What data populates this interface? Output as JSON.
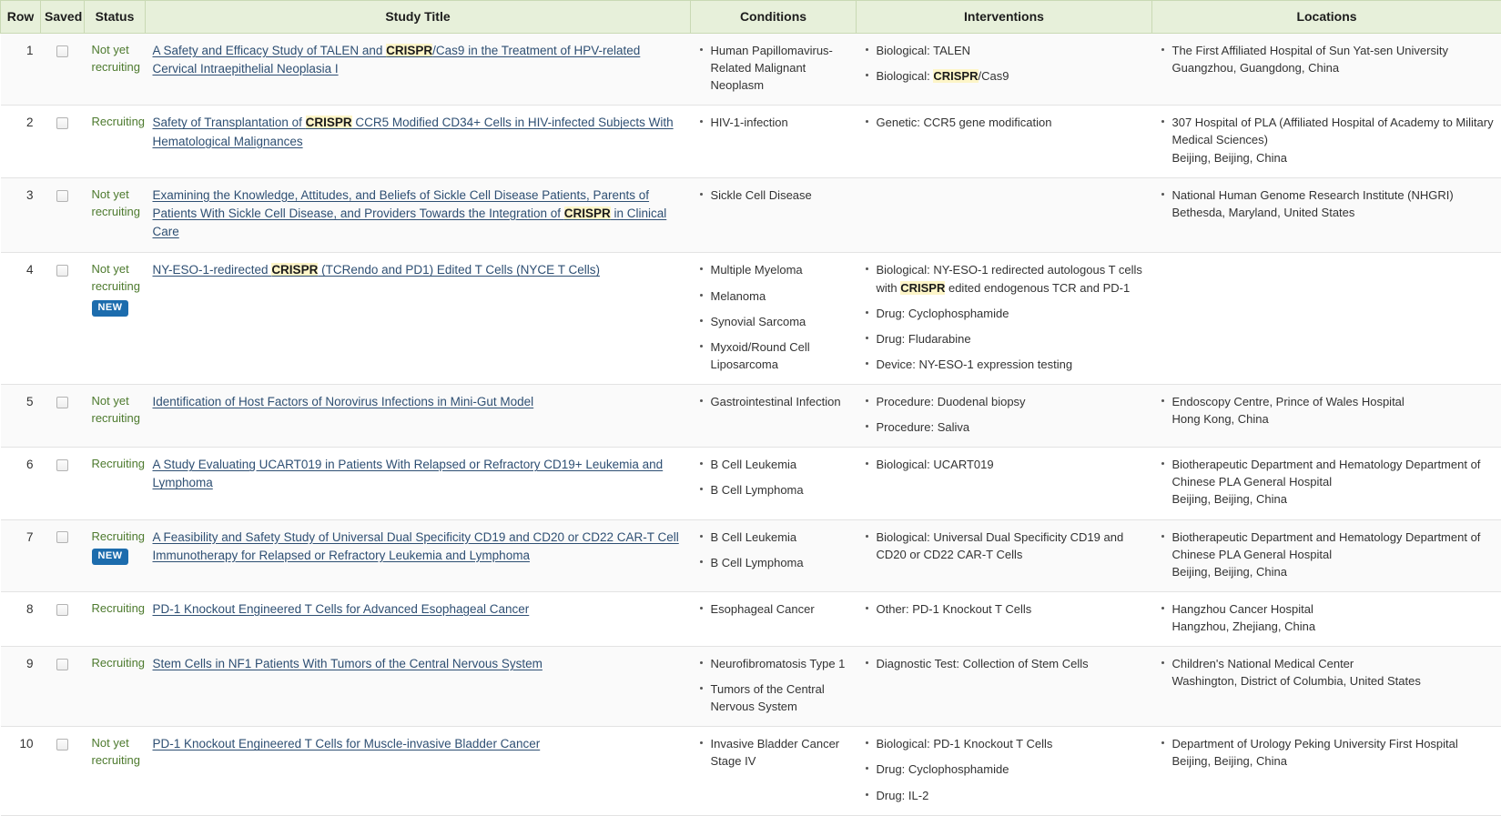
{
  "table": {
    "columns": [
      {
        "key": "row",
        "label": "Row"
      },
      {
        "key": "saved",
        "label": "Saved"
      },
      {
        "key": "status",
        "label": "Status"
      },
      {
        "key": "title",
        "label": "Study Title"
      },
      {
        "key": "conditions",
        "label": "Conditions"
      },
      {
        "key": "interventions",
        "label": "Interventions"
      },
      {
        "key": "locations",
        "label": "Locations"
      }
    ],
    "search_term_highlighted": "CRISPR",
    "badge_new_label": "NEW",
    "colors": {
      "header_bg": "#e7f0da",
      "header_border": "#c9d9b4",
      "status_green": "#4d7a2e",
      "link_blue": "#2e4f73",
      "highlight_yellow": "#fdf5c8",
      "badge_blue": "#1c6cad",
      "row_stripe": "#fafafa"
    },
    "rows": [
      {
        "row": "1",
        "saved": false,
        "status": "Not yet recruiting",
        "new": false,
        "title": "A Safety and Efficacy Study of TALEN and CRISPR/Cas9 in the Treatment of HPV-related Cervical Intraepithelial Neoplasia I",
        "conditions": [
          "Human Papillomavirus-Related Malignant Neoplasm"
        ],
        "interventions": [
          "Biological: TALEN",
          "Biological: CRISPR/Cas9"
        ],
        "locations": [
          {
            "name": "The First Affiliated Hospital of Sun Yat-sen University",
            "place": "Guangzhou, Guangdong, China"
          }
        ]
      },
      {
        "row": "2",
        "saved": false,
        "status": "Recruiting",
        "new": false,
        "title": "Safety of Transplantation of CRISPR CCR5 Modified CD34+ Cells in HIV-infected Subjects With Hematological Malignances",
        "conditions": [
          "HIV-1-infection"
        ],
        "interventions": [
          "Genetic: CCR5 gene modification"
        ],
        "locations": [
          {
            "name": "307 Hospital of PLA (Affiliated Hospital of Academy to Military Medical Sciences)",
            "place": "Beijing, Beijing, China"
          }
        ]
      },
      {
        "row": "3",
        "saved": false,
        "status": "Not yet recruiting",
        "new": false,
        "title": "Examining the Knowledge, Attitudes, and Beliefs of Sickle Cell Disease Patients, Parents of Patients With Sickle Cell Disease, and Providers Towards the Integration of CRISPR in Clinical Care",
        "conditions": [
          "Sickle Cell Disease"
        ],
        "interventions": [],
        "locations": [
          {
            "name": "National Human Genome Research Institute (NHGRI)",
            "place": "Bethesda, Maryland, United States"
          }
        ]
      },
      {
        "row": "4",
        "saved": false,
        "status": "Not yet recruiting",
        "new": true,
        "title": "NY-ESO-1-redirected CRISPR (TCRendo and PD1) Edited T Cells (NYCE T Cells)",
        "conditions": [
          "Multiple Myeloma",
          "Melanoma",
          "Synovial Sarcoma",
          "Myxoid/Round Cell Liposarcoma"
        ],
        "interventions": [
          "Biological: NY-ESO-1 redirected autologous T cells with CRISPR edited endogenous TCR and PD-1",
          "Drug: Cyclophosphamide",
          "Drug: Fludarabine",
          "Device: NY-ESO-1 expression testing"
        ],
        "locations": []
      },
      {
        "row": "5",
        "saved": false,
        "status": "Not yet recruiting",
        "new": false,
        "title": "Identification of Host Factors of Norovirus Infections in Mini-Gut Model",
        "conditions": [
          "Gastrointestinal Infection"
        ],
        "interventions": [
          "Procedure: Duodenal biopsy",
          "Procedure: Saliva"
        ],
        "locations": [
          {
            "name": "Endoscopy Centre, Prince of Wales Hospital",
            "place": "Hong Kong, China"
          }
        ]
      },
      {
        "row": "6",
        "saved": false,
        "status": "Recruiting",
        "new": false,
        "title": "A Study Evaluating UCART019 in Patients With Relapsed or Refractory CD19+ Leukemia and Lymphoma",
        "conditions": [
          "B Cell Leukemia",
          "B Cell Lymphoma"
        ],
        "interventions": [
          "Biological: UCART019"
        ],
        "locations": [
          {
            "name": "Biotherapeutic Department and Hematology Department of Chinese PLA General Hospital",
            "place": "Beijing, Beijing, China"
          }
        ]
      },
      {
        "row": "7",
        "saved": false,
        "status": "Recruiting",
        "new": true,
        "title": "A Feasibility and Safety Study of Universal Dual Specificity CD19 and CD20 or CD22 CAR-T Cell Immunotherapy for Relapsed or Refractory Leukemia and Lymphoma",
        "conditions": [
          "B Cell Leukemia",
          "B Cell Lymphoma"
        ],
        "interventions": [
          "Biological: Universal Dual Specificity CD19 and CD20 or CD22 CAR-T Cells"
        ],
        "locations": [
          {
            "name": "Biotherapeutic Department and Hematology Department of Chinese PLA General Hospital",
            "place": "Beijing, Beijing, China"
          }
        ]
      },
      {
        "row": "8",
        "saved": false,
        "status": "Recruiting",
        "new": false,
        "title": "PD-1 Knockout Engineered T Cells for Advanced Esophageal Cancer",
        "conditions": [
          "Esophageal Cancer"
        ],
        "interventions": [
          "Other: PD-1 Knockout T Cells"
        ],
        "locations": [
          {
            "name": "Hangzhou Cancer Hospital",
            "place": "Hangzhou, Zhejiang, China"
          }
        ]
      },
      {
        "row": "9",
        "saved": false,
        "status": "Recruiting",
        "new": false,
        "title": "Stem Cells in NF1 Patients With Tumors of the Central Nervous System",
        "conditions": [
          "Neurofibromatosis Type 1",
          "Tumors of the Central Nervous System"
        ],
        "interventions": [
          "Diagnostic Test: Collection of Stem Cells"
        ],
        "locations": [
          {
            "name": "Children's National Medical Center",
            "place": "Washington, District of Columbia, United States"
          }
        ]
      },
      {
        "row": "10",
        "saved": false,
        "status": "Not yet recruiting",
        "new": false,
        "title": "PD-1 Knockout Engineered T Cells for Muscle-invasive Bladder Cancer",
        "conditions": [
          "Invasive Bladder Cancer Stage IV"
        ],
        "interventions": [
          "Biological: PD-1 Knockout T Cells",
          "Drug: Cyclophosphamide",
          "Drug: IL-2"
        ],
        "locations": [
          {
            "name": "Department of Urology Peking University First Hospital",
            "place": "Beijing, Beijing, China"
          }
        ]
      }
    ]
  }
}
